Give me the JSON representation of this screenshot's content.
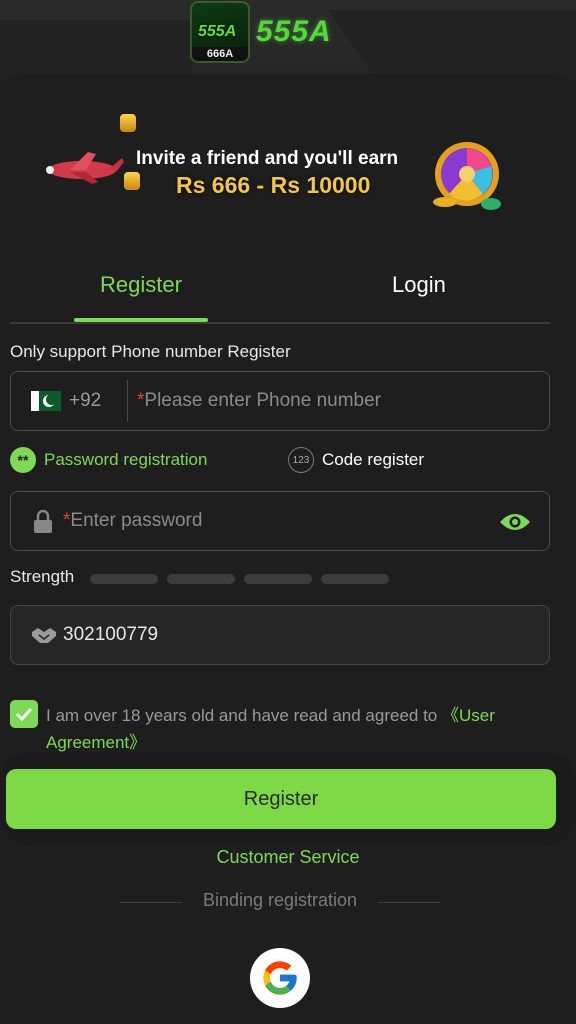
{
  "header": {
    "logo_badge_text": "555A",
    "logo_badge_sub": "666A",
    "logo_text": "555A"
  },
  "banner": {
    "line1": "Invite a friend and you'll earn",
    "line2": "Rs 666 - Rs 10000"
  },
  "tabs": [
    {
      "label": "Register",
      "active": true
    },
    {
      "label": "Login",
      "active": false
    }
  ],
  "support_text": "Only support Phone number Register",
  "phone": {
    "country_code": "+92",
    "required_mark": "*",
    "placeholder": "Please enter Phone number",
    "flag_icon": "pakistan-flag-icon"
  },
  "registration_options": {
    "password": {
      "label": "Password registration",
      "icon_text": "**",
      "selected": true
    },
    "code": {
      "label": "Code register",
      "icon_text": "123",
      "selected": false
    }
  },
  "password": {
    "required_mark": "*",
    "placeholder": "Enter password"
  },
  "strength": {
    "label": "Strength",
    "level": 0
  },
  "invite_code": {
    "value": "302100779"
  },
  "agreement": {
    "checked": true,
    "text": "I am over 18 years old and have read and agreed to ",
    "link": "《User Agreement》"
  },
  "register_button": "Register",
  "customer_service": "Customer Service",
  "binding_registration": "Binding registration",
  "colors": {
    "accent": "#7ed957",
    "background": "#1e1e1e",
    "required": "#e0453a"
  }
}
